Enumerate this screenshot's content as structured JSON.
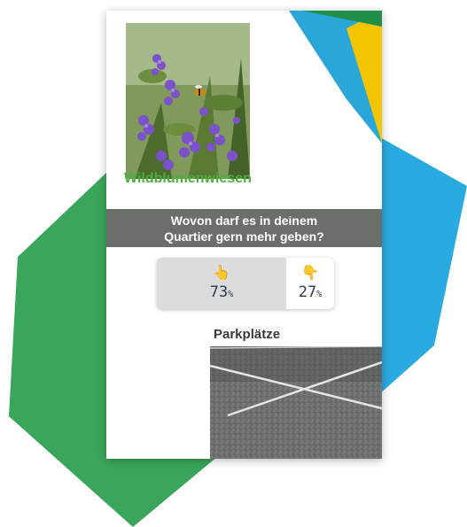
{
  "story": {
    "option_a": {
      "label": "Wildblumenwiesen",
      "image": "flower-meadow-photo"
    },
    "question": {
      "line1": "Wovon darf es in deinem",
      "line2": "Quartier gern mehr geben?"
    },
    "poll": {
      "left_emoji": "👆",
      "left_percent": "73",
      "right_emoji": "👇",
      "right_percent": "27",
      "percent_sign": "%",
      "left_share": 0.73
    },
    "option_b": {
      "label": "Parkplätze",
      "image": "parking-lot-photo"
    }
  },
  "colors": {
    "green_hex": "#3aa65b",
    "blue_hex": "#29abe2",
    "yellow_accent": "#f2c500",
    "banner": "#6b6f69",
    "label_green": "#4caf3d"
  }
}
